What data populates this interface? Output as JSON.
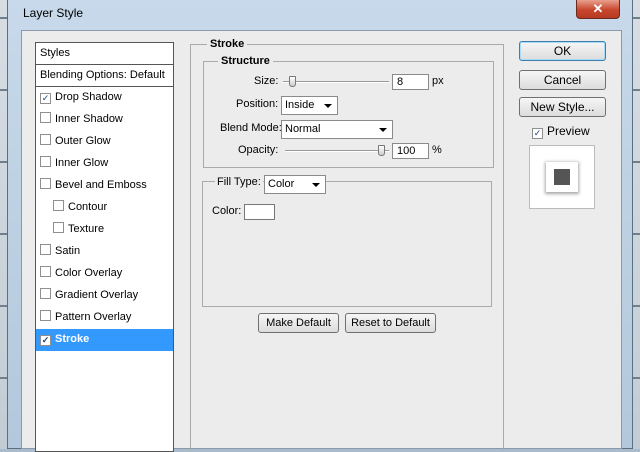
{
  "window": {
    "title": "Layer Style",
    "close_glyph": "✕"
  },
  "styles_list": {
    "items": [
      {
        "label": "Styles",
        "checkbox": false,
        "checked": false,
        "selected": false,
        "indent": 0
      },
      {
        "label": "Blending Options: Default",
        "checkbox": false,
        "checked": false,
        "selected": false,
        "indent": 0
      },
      {
        "label": "Drop Shadow",
        "checkbox": true,
        "checked": true,
        "selected": false,
        "indent": 0
      },
      {
        "label": "Inner Shadow",
        "checkbox": true,
        "checked": false,
        "selected": false,
        "indent": 0
      },
      {
        "label": "Outer Glow",
        "checkbox": true,
        "checked": false,
        "selected": false,
        "indent": 0
      },
      {
        "label": "Inner Glow",
        "checkbox": true,
        "checked": false,
        "selected": false,
        "indent": 0
      },
      {
        "label": "Bevel and Emboss",
        "checkbox": true,
        "checked": false,
        "selected": false,
        "indent": 0
      },
      {
        "label": "Contour",
        "checkbox": true,
        "checked": false,
        "selected": false,
        "indent": 1
      },
      {
        "label": "Texture",
        "checkbox": true,
        "checked": false,
        "selected": false,
        "indent": 1
      },
      {
        "label": "Satin",
        "checkbox": true,
        "checked": false,
        "selected": false,
        "indent": 0
      },
      {
        "label": "Color Overlay",
        "checkbox": true,
        "checked": false,
        "selected": false,
        "indent": 0
      },
      {
        "label": "Gradient Overlay",
        "checkbox": true,
        "checked": false,
        "selected": false,
        "indent": 0
      },
      {
        "label": "Pattern Overlay",
        "checkbox": true,
        "checked": false,
        "selected": false,
        "indent": 0
      },
      {
        "label": "Stroke",
        "checkbox": true,
        "checked": true,
        "selected": true,
        "indent": 0
      }
    ]
  },
  "stroke": {
    "title": "Stroke",
    "structure": {
      "title": "Structure",
      "size_label": "Size:",
      "size_value": "8",
      "size_unit": "px",
      "position_label": "Position:",
      "position_value": "Inside",
      "blend_mode_label": "Blend Mode:",
      "blend_mode_value": "Normal",
      "opacity_label": "Opacity:",
      "opacity_value": "100",
      "opacity_unit": "%"
    },
    "fill": {
      "fill_type_label": "Fill Type:",
      "fill_type_value": "Color",
      "color_label": "Color:",
      "color_value": "#ffffff"
    },
    "make_default_label": "Make Default",
    "reset_default_label": "Reset to Default"
  },
  "buttons": {
    "ok_label": "OK",
    "cancel_label": "Cancel",
    "new_style_label": "New Style...",
    "preview_label": "Preview",
    "preview_checked": true
  },
  "colors": {
    "selection": "#3399ff",
    "close_button": "#c8452d"
  }
}
